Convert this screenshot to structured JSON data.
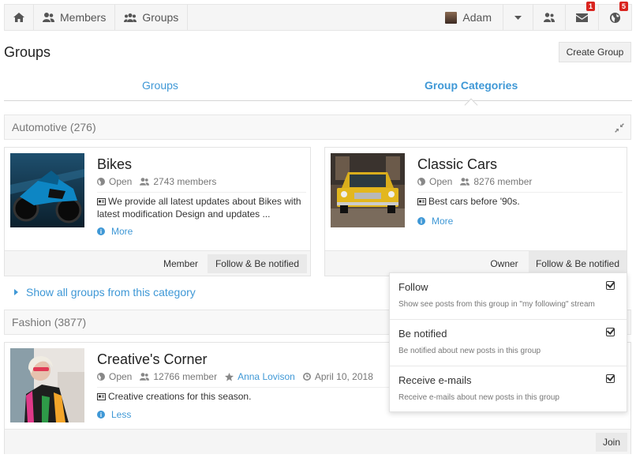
{
  "topbar": {
    "members_label": "Members",
    "groups_label": "Groups",
    "user_name": "Adam",
    "messages_count": "1",
    "notifications_count": "5"
  },
  "page": {
    "title": "Groups",
    "create_button": "Create Group"
  },
  "tabs": [
    {
      "label": "Groups",
      "active": false
    },
    {
      "label": "Group Categories",
      "active": true
    }
  ],
  "categories": [
    {
      "header": "Automotive (276)",
      "groups": [
        {
          "title": "Bikes",
          "status": "Open",
          "members": "2743 members",
          "description": "We provide all latest updates about Bikes with latest modification Design and updates ...",
          "more": "More",
          "buttons": [
            "Member",
            "Follow & Be notified"
          ]
        },
        {
          "title": "Classic Cars",
          "status": "Open",
          "members": "8276 member",
          "description": "Best cars before '90s.",
          "more": "More",
          "buttons": [
            "Owner",
            "Follow & Be notified"
          ]
        }
      ],
      "show_all": "Show all groups from this category"
    },
    {
      "header": "Fashion (3877)",
      "groups": [
        {
          "title": "Creative's Corner",
          "status": "Open",
          "members": "12766 member",
          "owner": "Anna Lovison",
          "date": "April 10, 2018",
          "description": "Creative creations for this season.",
          "more": "Less",
          "buttons": [
            "Join"
          ]
        }
      ]
    }
  ],
  "dropdown": [
    {
      "title": "Follow",
      "desc": "Show see posts from this group in \"my following\" stream",
      "checked": true
    },
    {
      "title": "Be notified",
      "desc": "Be notified about new posts in this group",
      "checked": true
    },
    {
      "title": "Receive e-mails",
      "desc": "Receive e-mails about new posts in this group",
      "checked": true
    }
  ],
  "colors": {
    "accent": "#3f98d6",
    "badge": "#d9241f"
  }
}
